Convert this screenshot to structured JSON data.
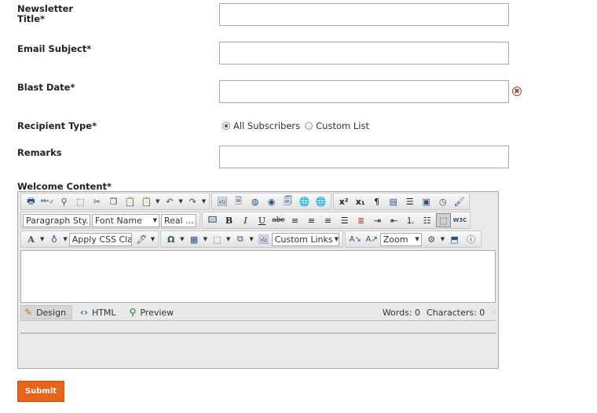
{
  "form": {
    "newsletter_title_label": "Newsletter Title*",
    "email_subject_label": "Email Subject*",
    "blast_date_label": "Blast Date*",
    "recipient_type_label": "Recipient Type*",
    "remarks_label": "Remarks",
    "welcome_content_label": "Welcome Content*",
    "newsletter_title_value": "",
    "email_subject_value": "",
    "blast_date_value": "",
    "remarks_value": "",
    "recipient_options": [
      {
        "label": "All Subscribers",
        "selected": true
      },
      {
        "label": "Custom List",
        "selected": false
      }
    ],
    "submit_label": "Submit"
  },
  "editor": {
    "paragraph_style": "Paragraph Sty..",
    "font_name": "Font Name",
    "font_size": "Real ...",
    "css_class": "Apply CSS Cla..",
    "custom_links": "Custom Links",
    "zoom": "Zoom",
    "modes": [
      {
        "label": "Design",
        "icon": "pencil-icon",
        "active": true
      },
      {
        "label": "HTML",
        "icon": "code-icon",
        "active": false
      },
      {
        "label": "Preview",
        "icon": "magnifier-icon",
        "active": false
      }
    ],
    "words": "Words: 0",
    "characters": "Characters: 0"
  },
  "colors": {
    "accent": "#e8641b",
    "clear_icon": "#9a4a33"
  }
}
